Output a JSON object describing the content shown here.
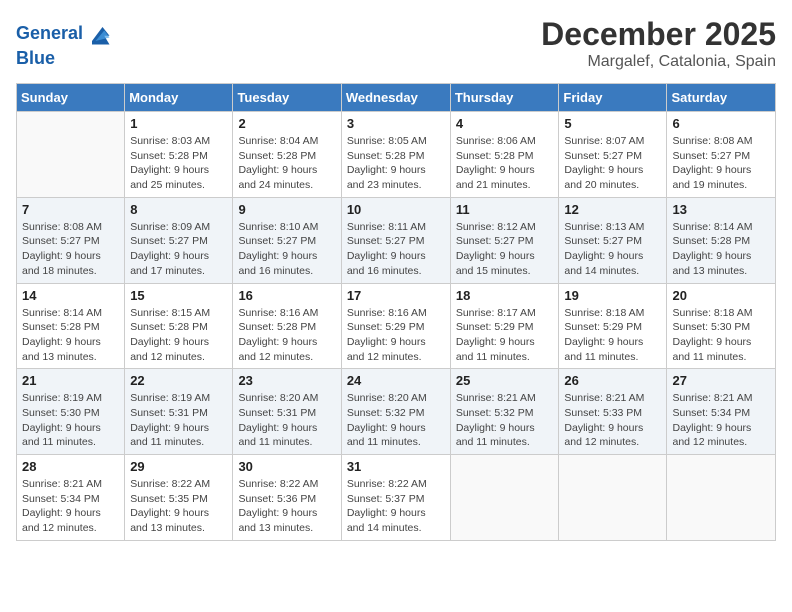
{
  "header": {
    "logo_line1": "General",
    "logo_line2": "Blue",
    "month": "December 2025",
    "location": "Margalef, Catalonia, Spain"
  },
  "days_of_week": [
    "Sunday",
    "Monday",
    "Tuesday",
    "Wednesday",
    "Thursday",
    "Friday",
    "Saturday"
  ],
  "weeks": [
    [
      {
        "day": "",
        "info": ""
      },
      {
        "day": "1",
        "info": "Sunrise: 8:03 AM\nSunset: 5:28 PM\nDaylight: 9 hours\nand 25 minutes."
      },
      {
        "day": "2",
        "info": "Sunrise: 8:04 AM\nSunset: 5:28 PM\nDaylight: 9 hours\nand 24 minutes."
      },
      {
        "day": "3",
        "info": "Sunrise: 8:05 AM\nSunset: 5:28 PM\nDaylight: 9 hours\nand 23 minutes."
      },
      {
        "day": "4",
        "info": "Sunrise: 8:06 AM\nSunset: 5:28 PM\nDaylight: 9 hours\nand 21 minutes."
      },
      {
        "day": "5",
        "info": "Sunrise: 8:07 AM\nSunset: 5:27 PM\nDaylight: 9 hours\nand 20 minutes."
      },
      {
        "day": "6",
        "info": "Sunrise: 8:08 AM\nSunset: 5:27 PM\nDaylight: 9 hours\nand 19 minutes."
      }
    ],
    [
      {
        "day": "7",
        "info": "Sunrise: 8:08 AM\nSunset: 5:27 PM\nDaylight: 9 hours\nand 18 minutes."
      },
      {
        "day": "8",
        "info": "Sunrise: 8:09 AM\nSunset: 5:27 PM\nDaylight: 9 hours\nand 17 minutes."
      },
      {
        "day": "9",
        "info": "Sunrise: 8:10 AM\nSunset: 5:27 PM\nDaylight: 9 hours\nand 16 minutes."
      },
      {
        "day": "10",
        "info": "Sunrise: 8:11 AM\nSunset: 5:27 PM\nDaylight: 9 hours\nand 16 minutes."
      },
      {
        "day": "11",
        "info": "Sunrise: 8:12 AM\nSunset: 5:27 PM\nDaylight: 9 hours\nand 15 minutes."
      },
      {
        "day": "12",
        "info": "Sunrise: 8:13 AM\nSunset: 5:27 PM\nDaylight: 9 hours\nand 14 minutes."
      },
      {
        "day": "13",
        "info": "Sunrise: 8:14 AM\nSunset: 5:28 PM\nDaylight: 9 hours\nand 13 minutes."
      }
    ],
    [
      {
        "day": "14",
        "info": "Sunrise: 8:14 AM\nSunset: 5:28 PM\nDaylight: 9 hours\nand 13 minutes."
      },
      {
        "day": "15",
        "info": "Sunrise: 8:15 AM\nSunset: 5:28 PM\nDaylight: 9 hours\nand 12 minutes."
      },
      {
        "day": "16",
        "info": "Sunrise: 8:16 AM\nSunset: 5:28 PM\nDaylight: 9 hours\nand 12 minutes."
      },
      {
        "day": "17",
        "info": "Sunrise: 8:16 AM\nSunset: 5:29 PM\nDaylight: 9 hours\nand 12 minutes."
      },
      {
        "day": "18",
        "info": "Sunrise: 8:17 AM\nSunset: 5:29 PM\nDaylight: 9 hours\nand 11 minutes."
      },
      {
        "day": "19",
        "info": "Sunrise: 8:18 AM\nSunset: 5:29 PM\nDaylight: 9 hours\nand 11 minutes."
      },
      {
        "day": "20",
        "info": "Sunrise: 8:18 AM\nSunset: 5:30 PM\nDaylight: 9 hours\nand 11 minutes."
      }
    ],
    [
      {
        "day": "21",
        "info": "Sunrise: 8:19 AM\nSunset: 5:30 PM\nDaylight: 9 hours\nand 11 minutes."
      },
      {
        "day": "22",
        "info": "Sunrise: 8:19 AM\nSunset: 5:31 PM\nDaylight: 9 hours\nand 11 minutes."
      },
      {
        "day": "23",
        "info": "Sunrise: 8:20 AM\nSunset: 5:31 PM\nDaylight: 9 hours\nand 11 minutes."
      },
      {
        "day": "24",
        "info": "Sunrise: 8:20 AM\nSunset: 5:32 PM\nDaylight: 9 hours\nand 11 minutes."
      },
      {
        "day": "25",
        "info": "Sunrise: 8:21 AM\nSunset: 5:32 PM\nDaylight: 9 hours\nand 11 minutes."
      },
      {
        "day": "26",
        "info": "Sunrise: 8:21 AM\nSunset: 5:33 PM\nDaylight: 9 hours\nand 12 minutes."
      },
      {
        "day": "27",
        "info": "Sunrise: 8:21 AM\nSunset: 5:34 PM\nDaylight: 9 hours\nand 12 minutes."
      }
    ],
    [
      {
        "day": "28",
        "info": "Sunrise: 8:21 AM\nSunset: 5:34 PM\nDaylight: 9 hours\nand 12 minutes."
      },
      {
        "day": "29",
        "info": "Sunrise: 8:22 AM\nSunset: 5:35 PM\nDaylight: 9 hours\nand 13 minutes."
      },
      {
        "day": "30",
        "info": "Sunrise: 8:22 AM\nSunset: 5:36 PM\nDaylight: 9 hours\nand 13 minutes."
      },
      {
        "day": "31",
        "info": "Sunrise: 8:22 AM\nSunset: 5:37 PM\nDaylight: 9 hours\nand 14 minutes."
      },
      {
        "day": "",
        "info": ""
      },
      {
        "day": "",
        "info": ""
      },
      {
        "day": "",
        "info": ""
      }
    ]
  ]
}
